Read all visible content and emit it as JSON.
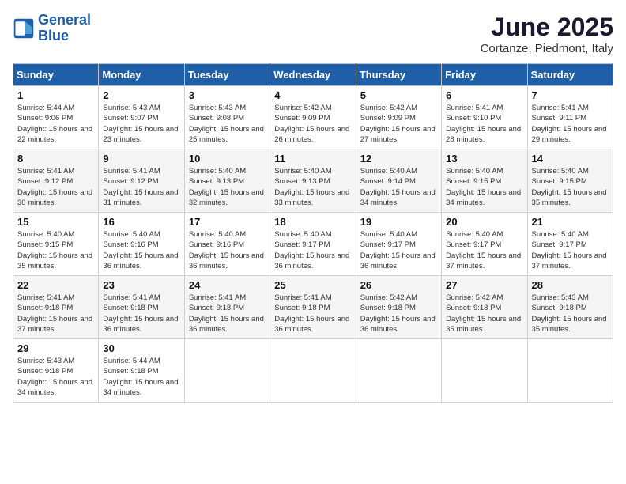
{
  "logo": {
    "line1": "General",
    "line2": "Blue"
  },
  "title": "June 2025",
  "subtitle": "Cortanze, Piedmont, Italy",
  "weekdays": [
    "Sunday",
    "Monday",
    "Tuesday",
    "Wednesday",
    "Thursday",
    "Friday",
    "Saturday"
  ],
  "weeks": [
    [
      {
        "day": "1",
        "sunrise": "5:44 AM",
        "sunset": "9:06 PM",
        "daylight": "15 hours and 22 minutes."
      },
      {
        "day": "2",
        "sunrise": "5:43 AM",
        "sunset": "9:07 PM",
        "daylight": "15 hours and 23 minutes."
      },
      {
        "day": "3",
        "sunrise": "5:43 AM",
        "sunset": "9:08 PM",
        "daylight": "15 hours and 25 minutes."
      },
      {
        "day": "4",
        "sunrise": "5:42 AM",
        "sunset": "9:09 PM",
        "daylight": "15 hours and 26 minutes."
      },
      {
        "day": "5",
        "sunrise": "5:42 AM",
        "sunset": "9:09 PM",
        "daylight": "15 hours and 27 minutes."
      },
      {
        "day": "6",
        "sunrise": "5:41 AM",
        "sunset": "9:10 PM",
        "daylight": "15 hours and 28 minutes."
      },
      {
        "day": "7",
        "sunrise": "5:41 AM",
        "sunset": "9:11 PM",
        "daylight": "15 hours and 29 minutes."
      }
    ],
    [
      {
        "day": "8",
        "sunrise": "5:41 AM",
        "sunset": "9:12 PM",
        "daylight": "15 hours and 30 minutes."
      },
      {
        "day": "9",
        "sunrise": "5:41 AM",
        "sunset": "9:12 PM",
        "daylight": "15 hours and 31 minutes."
      },
      {
        "day": "10",
        "sunrise": "5:40 AM",
        "sunset": "9:13 PM",
        "daylight": "15 hours and 32 minutes."
      },
      {
        "day": "11",
        "sunrise": "5:40 AM",
        "sunset": "9:13 PM",
        "daylight": "15 hours and 33 minutes."
      },
      {
        "day": "12",
        "sunrise": "5:40 AM",
        "sunset": "9:14 PM",
        "daylight": "15 hours and 34 minutes."
      },
      {
        "day": "13",
        "sunrise": "5:40 AM",
        "sunset": "9:15 PM",
        "daylight": "15 hours and 34 minutes."
      },
      {
        "day": "14",
        "sunrise": "5:40 AM",
        "sunset": "9:15 PM",
        "daylight": "15 hours and 35 minutes."
      }
    ],
    [
      {
        "day": "15",
        "sunrise": "5:40 AM",
        "sunset": "9:15 PM",
        "daylight": "15 hours and 35 minutes."
      },
      {
        "day": "16",
        "sunrise": "5:40 AM",
        "sunset": "9:16 PM",
        "daylight": "15 hours and 36 minutes."
      },
      {
        "day": "17",
        "sunrise": "5:40 AM",
        "sunset": "9:16 PM",
        "daylight": "15 hours and 36 minutes."
      },
      {
        "day": "18",
        "sunrise": "5:40 AM",
        "sunset": "9:17 PM",
        "daylight": "15 hours and 36 minutes."
      },
      {
        "day": "19",
        "sunrise": "5:40 AM",
        "sunset": "9:17 PM",
        "daylight": "15 hours and 36 minutes."
      },
      {
        "day": "20",
        "sunrise": "5:40 AM",
        "sunset": "9:17 PM",
        "daylight": "15 hours and 37 minutes."
      },
      {
        "day": "21",
        "sunrise": "5:40 AM",
        "sunset": "9:17 PM",
        "daylight": "15 hours and 37 minutes."
      }
    ],
    [
      {
        "day": "22",
        "sunrise": "5:41 AM",
        "sunset": "9:18 PM",
        "daylight": "15 hours and 37 minutes."
      },
      {
        "day": "23",
        "sunrise": "5:41 AM",
        "sunset": "9:18 PM",
        "daylight": "15 hours and 36 minutes."
      },
      {
        "day": "24",
        "sunrise": "5:41 AM",
        "sunset": "9:18 PM",
        "daylight": "15 hours and 36 minutes."
      },
      {
        "day": "25",
        "sunrise": "5:41 AM",
        "sunset": "9:18 PM",
        "daylight": "15 hours and 36 minutes."
      },
      {
        "day": "26",
        "sunrise": "5:42 AM",
        "sunset": "9:18 PM",
        "daylight": "15 hours and 36 minutes."
      },
      {
        "day": "27",
        "sunrise": "5:42 AM",
        "sunset": "9:18 PM",
        "daylight": "15 hours and 35 minutes."
      },
      {
        "day": "28",
        "sunrise": "5:43 AM",
        "sunset": "9:18 PM",
        "daylight": "15 hours and 35 minutes."
      }
    ],
    [
      {
        "day": "29",
        "sunrise": "5:43 AM",
        "sunset": "9:18 PM",
        "daylight": "15 hours and 34 minutes."
      },
      {
        "day": "30",
        "sunrise": "5:44 AM",
        "sunset": "9:18 PM",
        "daylight": "15 hours and 34 minutes."
      },
      null,
      null,
      null,
      null,
      null
    ]
  ]
}
